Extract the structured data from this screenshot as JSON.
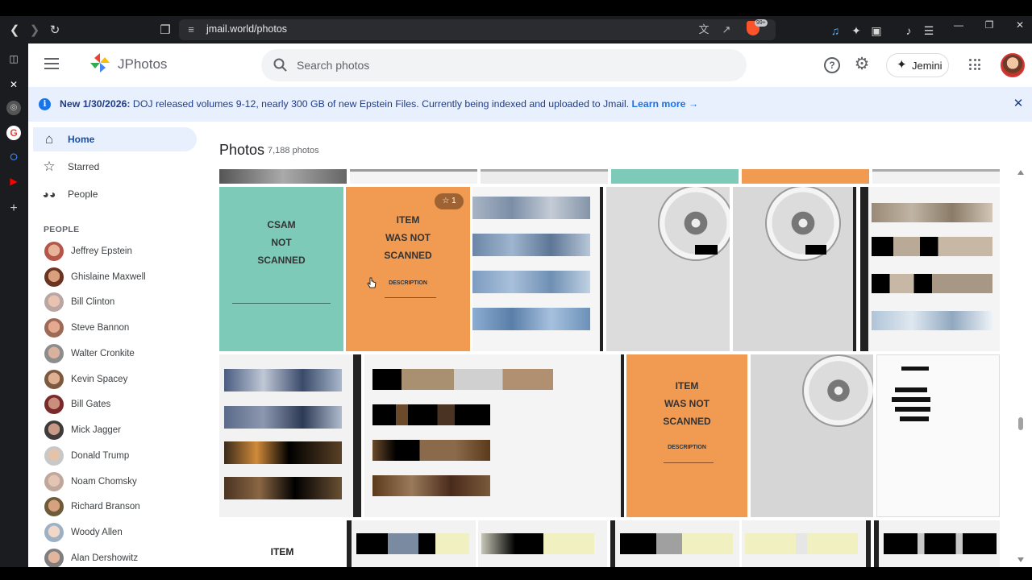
{
  "browser": {
    "url": "jmail.world/photos",
    "brave_badge": "99+"
  },
  "app": {
    "name": "JPhotos",
    "search_placeholder": "Search photos",
    "jemini_label": "Jemini"
  },
  "banner": {
    "bold_text": "New 1/30/2026:",
    "text": " DOJ released volumes 9-12, nearly 300 GB of new Epstein Files. Currently being indexed and uploaded to Jmail. ",
    "link": "Learn more →",
    "color": "#e8f0fe"
  },
  "nav": [
    {
      "label": "Home",
      "icon": "home-icon"
    },
    {
      "label": "Starred",
      "icon": "star-icon"
    },
    {
      "label": "People",
      "icon": "people-icon"
    }
  ],
  "people_heading": "PEOPLE",
  "people": [
    {
      "name": "Jeffrey Epstein"
    },
    {
      "name": "Ghislaine Maxwell"
    },
    {
      "name": "Bill Clinton"
    },
    {
      "name": "Steve Bannon"
    },
    {
      "name": "Walter Cronkite"
    },
    {
      "name": "Kevin Spacey"
    },
    {
      "name": "Bill Gates"
    },
    {
      "name": "Mick Jagger"
    },
    {
      "name": "Donald Trump"
    },
    {
      "name": "Noam Chomsky"
    },
    {
      "name": "Richard Branson"
    },
    {
      "name": "Woody Allen"
    },
    {
      "name": "Alan Dershowitz"
    }
  ],
  "main": {
    "title": "Photos",
    "count": "7,188 photos"
  },
  "tiles": {
    "csam": {
      "lines": [
        "CSAM",
        "NOT",
        "SCANNED"
      ],
      "color": "#7ecab8"
    },
    "item1": {
      "lines": [
        "ITEM",
        "WAS NOT",
        "SCANNED"
      ],
      "description": "DESCRIPTION",
      "star_count": "1",
      "color": "#f09a52"
    },
    "item2": {
      "lines": [
        "ITEM",
        "WAS NOT",
        "SCANNED"
      ],
      "description": "DESCRIPTION",
      "color": "#f09a52"
    },
    "item3": {
      "label": "ITEM"
    }
  }
}
